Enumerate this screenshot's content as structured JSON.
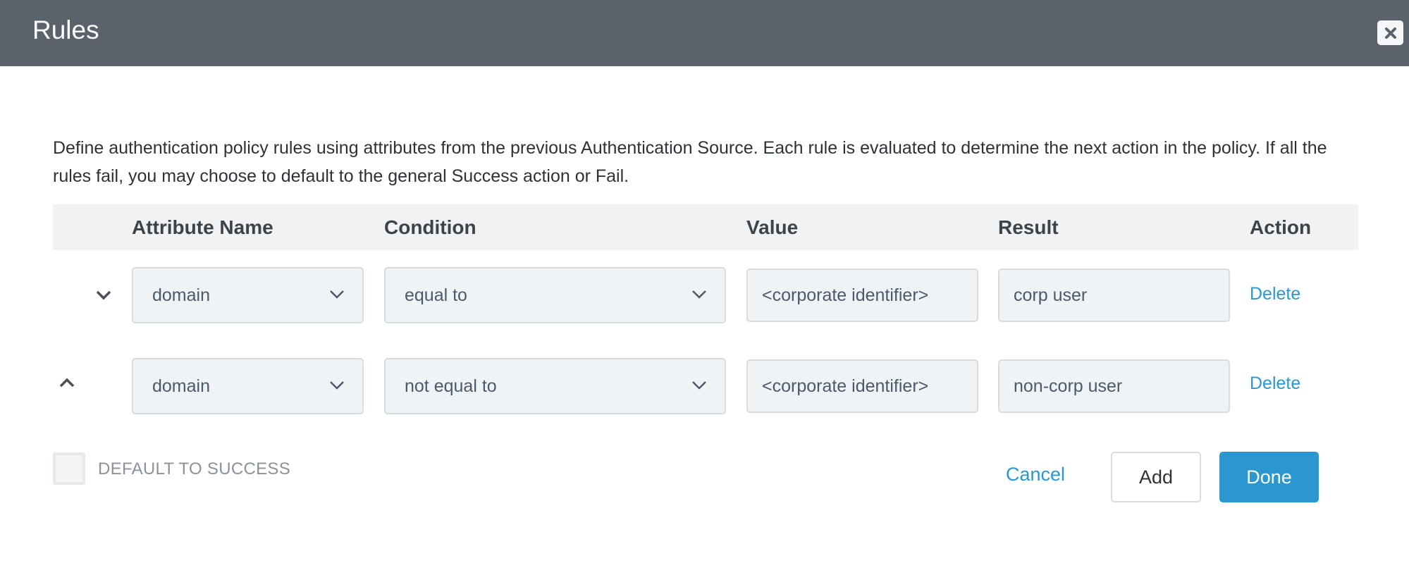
{
  "dialog": {
    "title": "Rules",
    "close_icon": "close-icon"
  },
  "description": "Define authentication policy rules using attributes from the previous Authentication Source. Each rule is evaluated to determine the next action in the policy. If all the rules fail, you may choose to default to the general Success action or Fail.",
  "table": {
    "headers": [
      "Attribute Name",
      "Condition",
      "Value",
      "Result",
      "Action"
    ],
    "rows": [
      {
        "toggle_icon": "chevron-down-icon",
        "attribute": "domain",
        "condition": "equal to",
        "value": "<corporate identifier>",
        "result": "corp user",
        "action": "Delete"
      },
      {
        "toggle_icon": "chevron-up-icon",
        "attribute": "domain",
        "condition": "not equal to",
        "value": "<corporate identifier>",
        "result": "non-corp user",
        "action": "Delete"
      }
    ]
  },
  "footer": {
    "default_to_success_label": "DEFAULT TO SUCCESS",
    "default_to_success_checked": false,
    "cancel_label": "Cancel",
    "add_label": "Add",
    "done_label": "Done"
  },
  "colors": {
    "header_bg": "#5a626b",
    "accent": "#2b97d0"
  }
}
